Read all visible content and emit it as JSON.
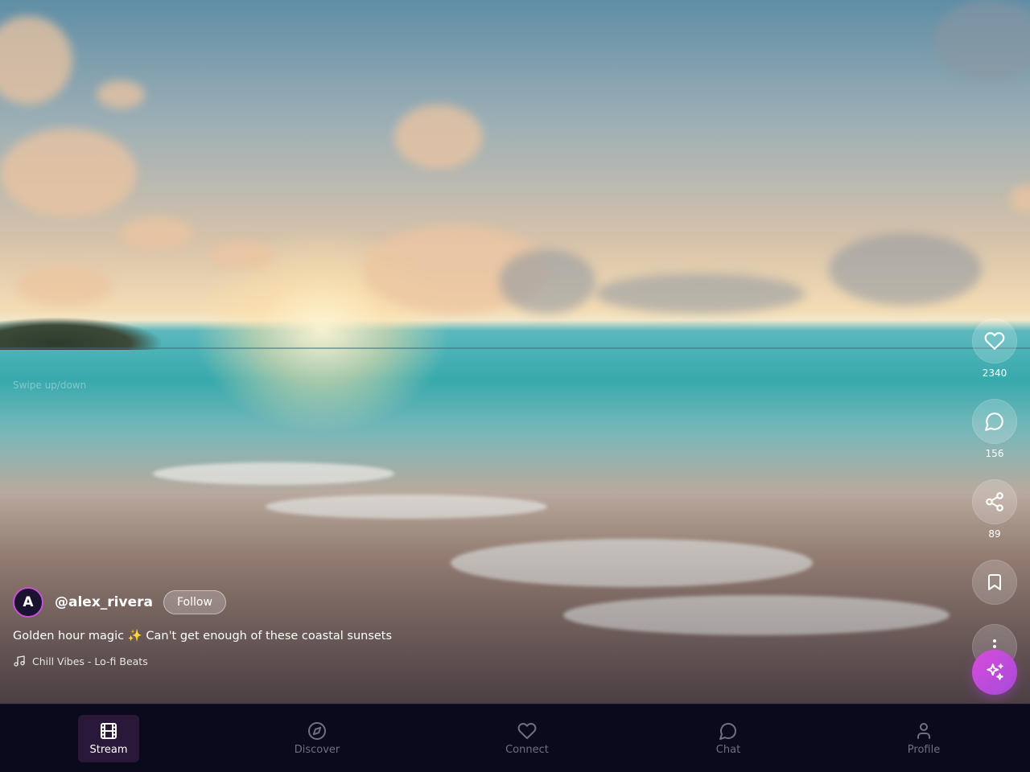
{
  "feed": {
    "swipe_hint": "Swipe up/down",
    "creator": {
      "avatar_initial": "A",
      "username": "@alex_rivera",
      "follow_label": "Follow"
    },
    "caption": "Golden hour magic ✨ Can't get enough of these coastal sunsets",
    "music": {
      "icon": "music-note-icon",
      "track": "Chill Vibes - Lo-fi Beats"
    }
  },
  "actions": [
    {
      "name": "like",
      "icon": "heart-icon",
      "count": "2340"
    },
    {
      "name": "comment",
      "icon": "comment-bubble-icon",
      "count": "156"
    },
    {
      "name": "share",
      "icon": "share-icon",
      "count": "89"
    },
    {
      "name": "bookmark",
      "icon": "bookmark-icon",
      "count": ""
    },
    {
      "name": "more",
      "icon": "more-vertical-icon",
      "count": ""
    }
  ],
  "fab": {
    "icon": "sparkles-icon"
  },
  "nav": {
    "items": [
      {
        "label": "Stream",
        "icon": "film-icon",
        "active": true
      },
      {
        "label": "Discover",
        "icon": "compass-icon",
        "active": false
      },
      {
        "label": "Connect",
        "icon": "heart-outline-icon",
        "active": false
      },
      {
        "label": "Chat",
        "icon": "chat-bubble-icon",
        "active": false
      },
      {
        "label": "Profile",
        "icon": "user-icon",
        "active": false
      }
    ]
  },
  "colors": {
    "nav_bg": "#0a0a1c",
    "nav_active_bg": "#2a1838",
    "accent": "#c94fd8",
    "nav_inactive": "#6f6f84"
  }
}
